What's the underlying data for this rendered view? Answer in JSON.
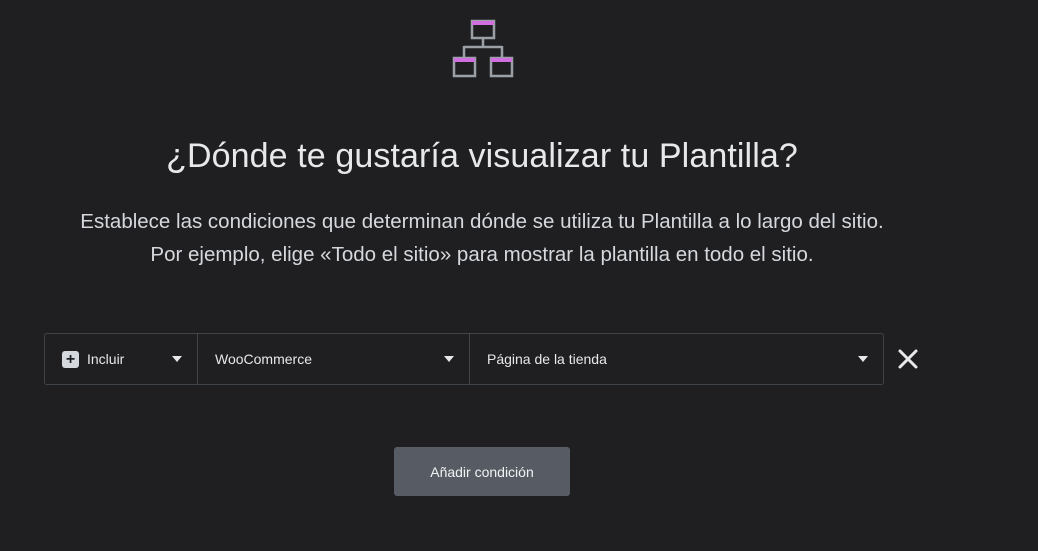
{
  "header": {
    "icon": "sitemap-icon",
    "title": "¿Dónde te gustaría visualizar tu Plantilla?",
    "subtitle_line1": "Establece las condiciones que determinan dónde se utiliza tu Plantilla a lo largo del sitio.",
    "subtitle_line2": "Por ejemplo, elige «Todo el sitio» para mostrar la plantilla en todo el sitio."
  },
  "condition": {
    "include_icon": "plus-square-icon",
    "include_value": "Incluir",
    "source_value": "WooCommerce",
    "target_value": "Página de la tienda",
    "remove_icon": "close-icon"
  },
  "actions": {
    "add_condition_label": "Añadir condición"
  },
  "colors": {
    "background": "#1f1f22",
    "accent": "#d16fe0",
    "border": "#3f444b",
    "button": "#575c64"
  }
}
